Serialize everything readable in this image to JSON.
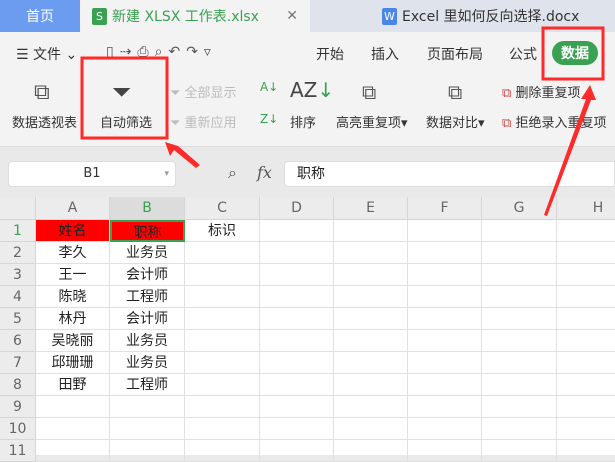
{
  "tabs": {
    "home": "首页",
    "xlsx": "新建 XLSX 工作表.xlsx",
    "docx": "Excel 里如何反向选择.docx"
  },
  "toolbar": {
    "file": "文件",
    "menus": [
      "开始",
      "插入",
      "页面布局",
      "公式",
      "数据"
    ],
    "active": "数据"
  },
  "ribbon": {
    "pivot": "数据透视表",
    "autofilter": "自动筛选",
    "show_all": "全部显示",
    "reapply": "重新应用",
    "sort": "排序",
    "highlight_dup": "高亮重复项",
    "compare": "数据对比",
    "remove_dup": "删除重复项",
    "reject_dup": "拒绝录入重复项"
  },
  "formula": {
    "name_box": "B1",
    "fx": "fx",
    "value": "职称"
  },
  "grid": {
    "columns": [
      "A",
      "B",
      "C",
      "D",
      "E",
      "F",
      "G",
      "H"
    ],
    "rows": [
      "1",
      "2",
      "3",
      "4",
      "5",
      "6",
      "7",
      "8",
      "9",
      "10",
      "11"
    ],
    "cells": [
      [
        "姓名",
        "职称",
        "标识"
      ],
      [
        "李久",
        "业务员"
      ],
      [
        "王一",
        "会计师"
      ],
      [
        "陈晓",
        "工程师"
      ],
      [
        "林丹",
        "会计师"
      ],
      [
        "吴晓丽",
        "业务员"
      ],
      [
        "邱珊珊",
        "业务员"
      ],
      [
        "田野",
        "工程师"
      ]
    ],
    "header_fill": "#ff0000",
    "selected": "B1"
  },
  "colors": {
    "accent": "#3aa152",
    "annotation": "#ff2a2a"
  }
}
